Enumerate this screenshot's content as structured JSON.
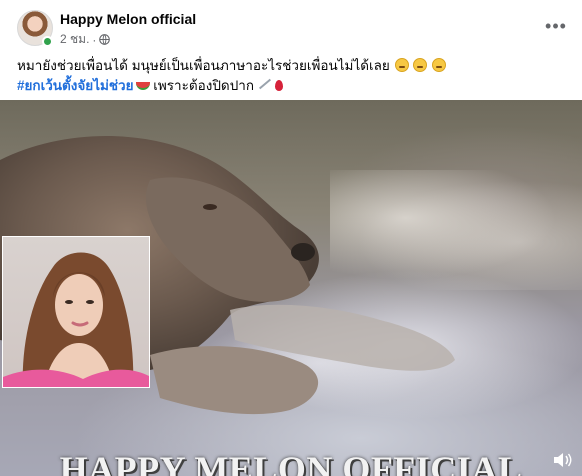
{
  "post": {
    "page_name": "Happy Melon official",
    "timestamp": "2 ชม.",
    "separator": "·",
    "privacy_icon": "globe-icon",
    "more_icon": "more-options-icon",
    "more_label": "•••"
  },
  "text": {
    "line1": "หมายังช่วยเพื่อนได้ มนุษย์เป็นเพื่อนภาษาอะไรช่วยเพื่อนไม่ได้เลย",
    "line1_emojis": [
      "😩",
      "😩",
      "😩"
    ],
    "hashtag": "#ยกเว้นตั้งจัยไม่ช่วย",
    "line2_rest": " เพราะต้องปิดปาก",
    "line2_emojis": [
      "watermelon",
      "knife",
      "drop-of-blood"
    ]
  },
  "video": {
    "watermark": "HAPPY MELON OFFICIAL",
    "volume_icon": "speaker-icon"
  },
  "colors": {
    "hashtag": "#216fdb",
    "online": "#31a24c",
    "meta_text": "#65676b"
  }
}
